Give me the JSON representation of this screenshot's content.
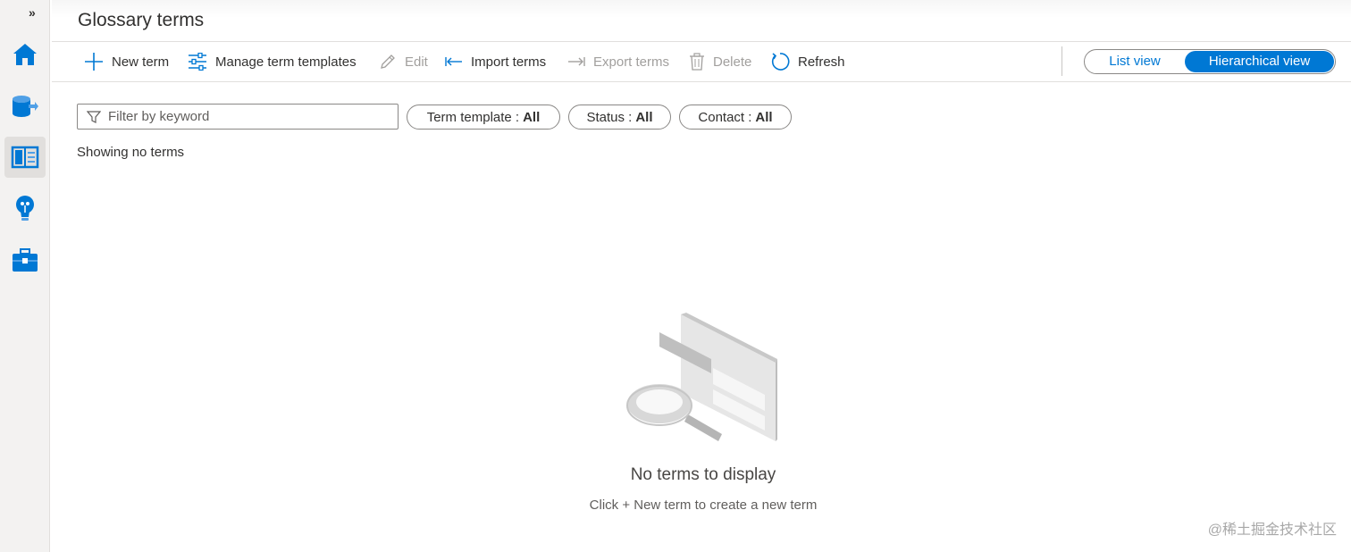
{
  "rail": {
    "expand_label": "»"
  },
  "header": {
    "title": "Glossary terms"
  },
  "toolbar": {
    "new_term": "New term",
    "manage_templates": "Manage term templates",
    "edit": "Edit",
    "import_terms": "Import terms",
    "export_terms": "Export terms",
    "delete": "Delete",
    "refresh": "Refresh"
  },
  "view_toggle": {
    "list": "List view",
    "hierarchical": "Hierarchical view",
    "selected": "Hierarchical view"
  },
  "filters": {
    "keyword_placeholder": "Filter by keyword",
    "term_template_label": "Term template :",
    "term_template_value": "All",
    "status_label": "Status :",
    "status_value": "All",
    "contact_label": "Contact :",
    "contact_value": "All"
  },
  "status_text": "Showing no terms",
  "empty_state": {
    "title": "No terms to display",
    "subtitle": "Click + New term to create a new term"
  },
  "watermark": "@稀土掘金技术社区",
  "colors": {
    "accent": "#0078d4",
    "disabled": "#a19f9d",
    "text": "#323130"
  }
}
